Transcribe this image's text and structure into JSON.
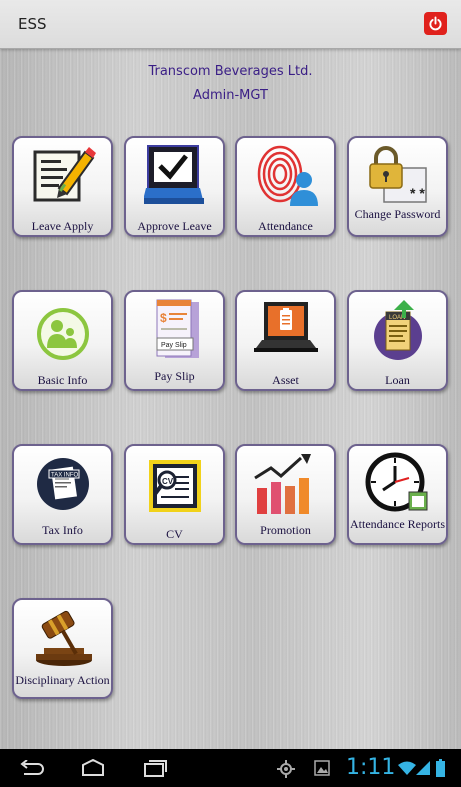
{
  "appbar": {
    "title": "ESS"
  },
  "company": {
    "name": "Transcom Beverages Ltd.",
    "role": "Admin-MGT"
  },
  "tiles": [
    {
      "label": "Leave Apply",
      "icon": "leave-apply-icon"
    },
    {
      "label": "Approve Leave",
      "icon": "approve-leave-icon"
    },
    {
      "label": "Attendance",
      "icon": "fingerprint-icon"
    },
    {
      "label": "Change Password",
      "icon": "lock-icon"
    },
    {
      "label": "Basic Info",
      "icon": "basic-info-icon"
    },
    {
      "label": "Pay Slip",
      "icon": "pay-slip-icon"
    },
    {
      "label": "Asset",
      "icon": "laptop-icon"
    },
    {
      "label": "Loan",
      "icon": "loan-icon"
    },
    {
      "label": "Tax Info",
      "icon": "tax-info-icon"
    },
    {
      "label": "CV",
      "icon": "cv-icon"
    },
    {
      "label": "Promotion",
      "icon": "promotion-chart-icon"
    },
    {
      "label": "Attendance Reports",
      "icon": "clock-icon"
    },
    {
      "label": "Disciplinary Action",
      "icon": "gavel-icon"
    }
  ],
  "icon_text": {
    "tax": "TAX INFO",
    "payslip": "Pay Slip",
    "loan": "LOAN",
    "cv": "CV"
  },
  "statusbar": {
    "time": "1:11"
  },
  "colors": {
    "accent": "#3a1e86",
    "power": "#e0211c",
    "clock": "#35b4e4"
  }
}
